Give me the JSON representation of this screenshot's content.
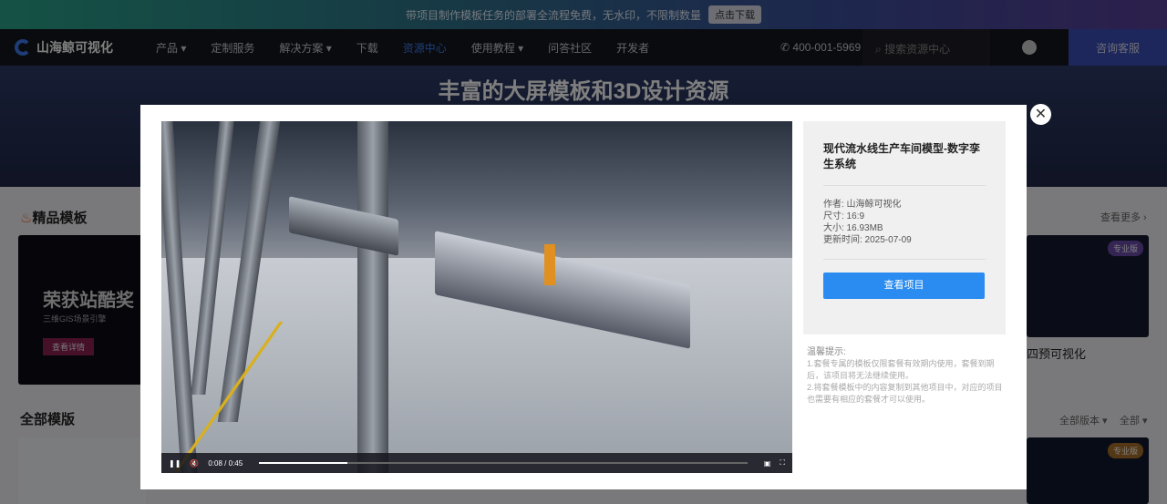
{
  "banner": {
    "text": "带项目制作模板任务的部署全流程免费，无水印，不限制数量",
    "download": "点击下载"
  },
  "nav": {
    "logo": "山海鲸可视化",
    "items": [
      "产品 ▾",
      "定制服务",
      "解决方案 ▾",
      "下载",
      "资源中心",
      "使用教程 ▾",
      "问答社区",
      "开发者"
    ],
    "phone": "400-001-5969",
    "search_placeholder": "搜索资源中心",
    "consult": "咨询客服"
  },
  "hero": {
    "title": "丰富的大屏模板和3D设计资源"
  },
  "content": {
    "featured": "精品模板",
    "more": "查看更多 ›",
    "promo_title": "荣获站酷奖",
    "promo_sub": "三维GIS场景引擎",
    "promo_btn": "查看详情",
    "right_card_title": "四预可视化",
    "all": "全部模版",
    "filters": [
      "全部版本 ▾",
      "全部 ▾"
    ],
    "badge1": "专业版",
    "badge2": "专业版"
  },
  "modal": {
    "title": "现代流水线生产车间模型-数字孪生系统",
    "author": "作者: 山海鲸可视化",
    "size": "尺寸: 16:9",
    "filesize": "大小: 16.93MB",
    "updated": "更新时间: 2025-07-09",
    "view_button": "查看项目",
    "tips_title": "温馨提示:",
    "tips": [
      "1.套餐专属的模板仅限套餐有效期内使用，套餐到期后，该项目将无法继续使用。",
      "2.将套餐模板中的内容复制到其他项目中，对应的项目也需要有相应的套餐才可以使用。"
    ],
    "video": {
      "time": "0:08 / 0:45",
      "progress": 0.18
    }
  }
}
